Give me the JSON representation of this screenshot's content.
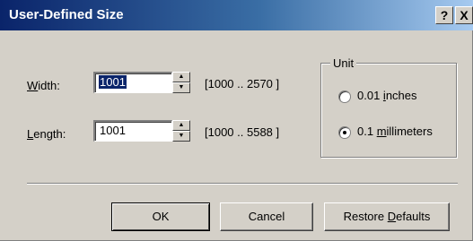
{
  "window": {
    "title": "User-Defined Size",
    "help_label": "?",
    "close_label": "X"
  },
  "width": {
    "label_accel": "W",
    "label_rest": "idth:",
    "value": "1001",
    "range": "[1000 .. 2570 ]"
  },
  "length": {
    "label_accel": "L",
    "label_rest": "ength:",
    "value": "1001",
    "range": "[1000 .. 5588 ]"
  },
  "unit": {
    "legend": "Unit",
    "options": [
      {
        "label_prefix": "0.01 ",
        "label_accel": "i",
        "label_rest": "nches",
        "checked": false
      },
      {
        "label_prefix": "0.1 ",
        "label_accel": "m",
        "label_rest": "illimeters",
        "checked": true
      }
    ]
  },
  "buttons": {
    "ok": "OK",
    "cancel": "Cancel",
    "restore_prefix": "Restore ",
    "restore_accel": "D",
    "restore_rest": "efaults"
  }
}
